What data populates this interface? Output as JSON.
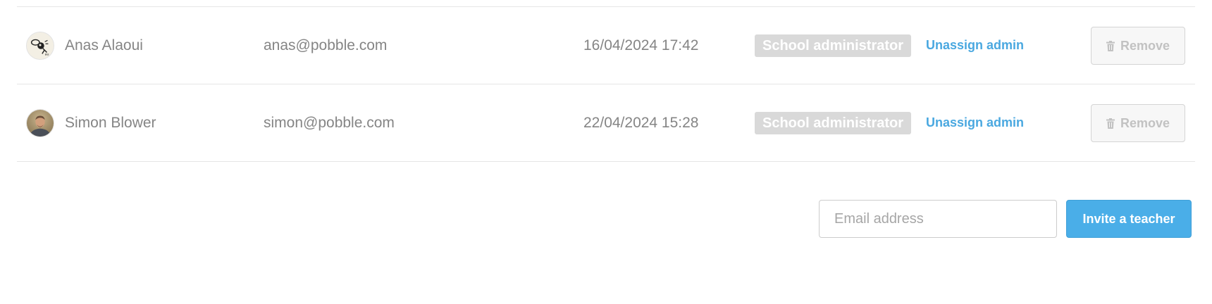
{
  "teachers": [
    {
      "avatar_icon": "cartoon-avatar-icon",
      "name": "Anas Alaoui",
      "email": "anas@pobble.com",
      "date": "16/04/2024 17:42",
      "role": "School administrator",
      "unassign_label": "Unassign admin",
      "remove_label": "Remove"
    },
    {
      "avatar_icon": "photo-avatar-icon",
      "name": "Simon Blower",
      "email": "simon@pobble.com",
      "date": "22/04/2024 15:28",
      "role": "School administrator",
      "unassign_label": "Unassign admin",
      "remove_label": "Remove"
    }
  ],
  "invite": {
    "email_placeholder": "Email address",
    "email_value": "",
    "button_label": "Invite a teacher"
  },
  "colors": {
    "accent": "#4aaee8",
    "link": "#4aa8e0",
    "badge_bg": "#d9d9d9",
    "divider": "#e6e6e6"
  }
}
